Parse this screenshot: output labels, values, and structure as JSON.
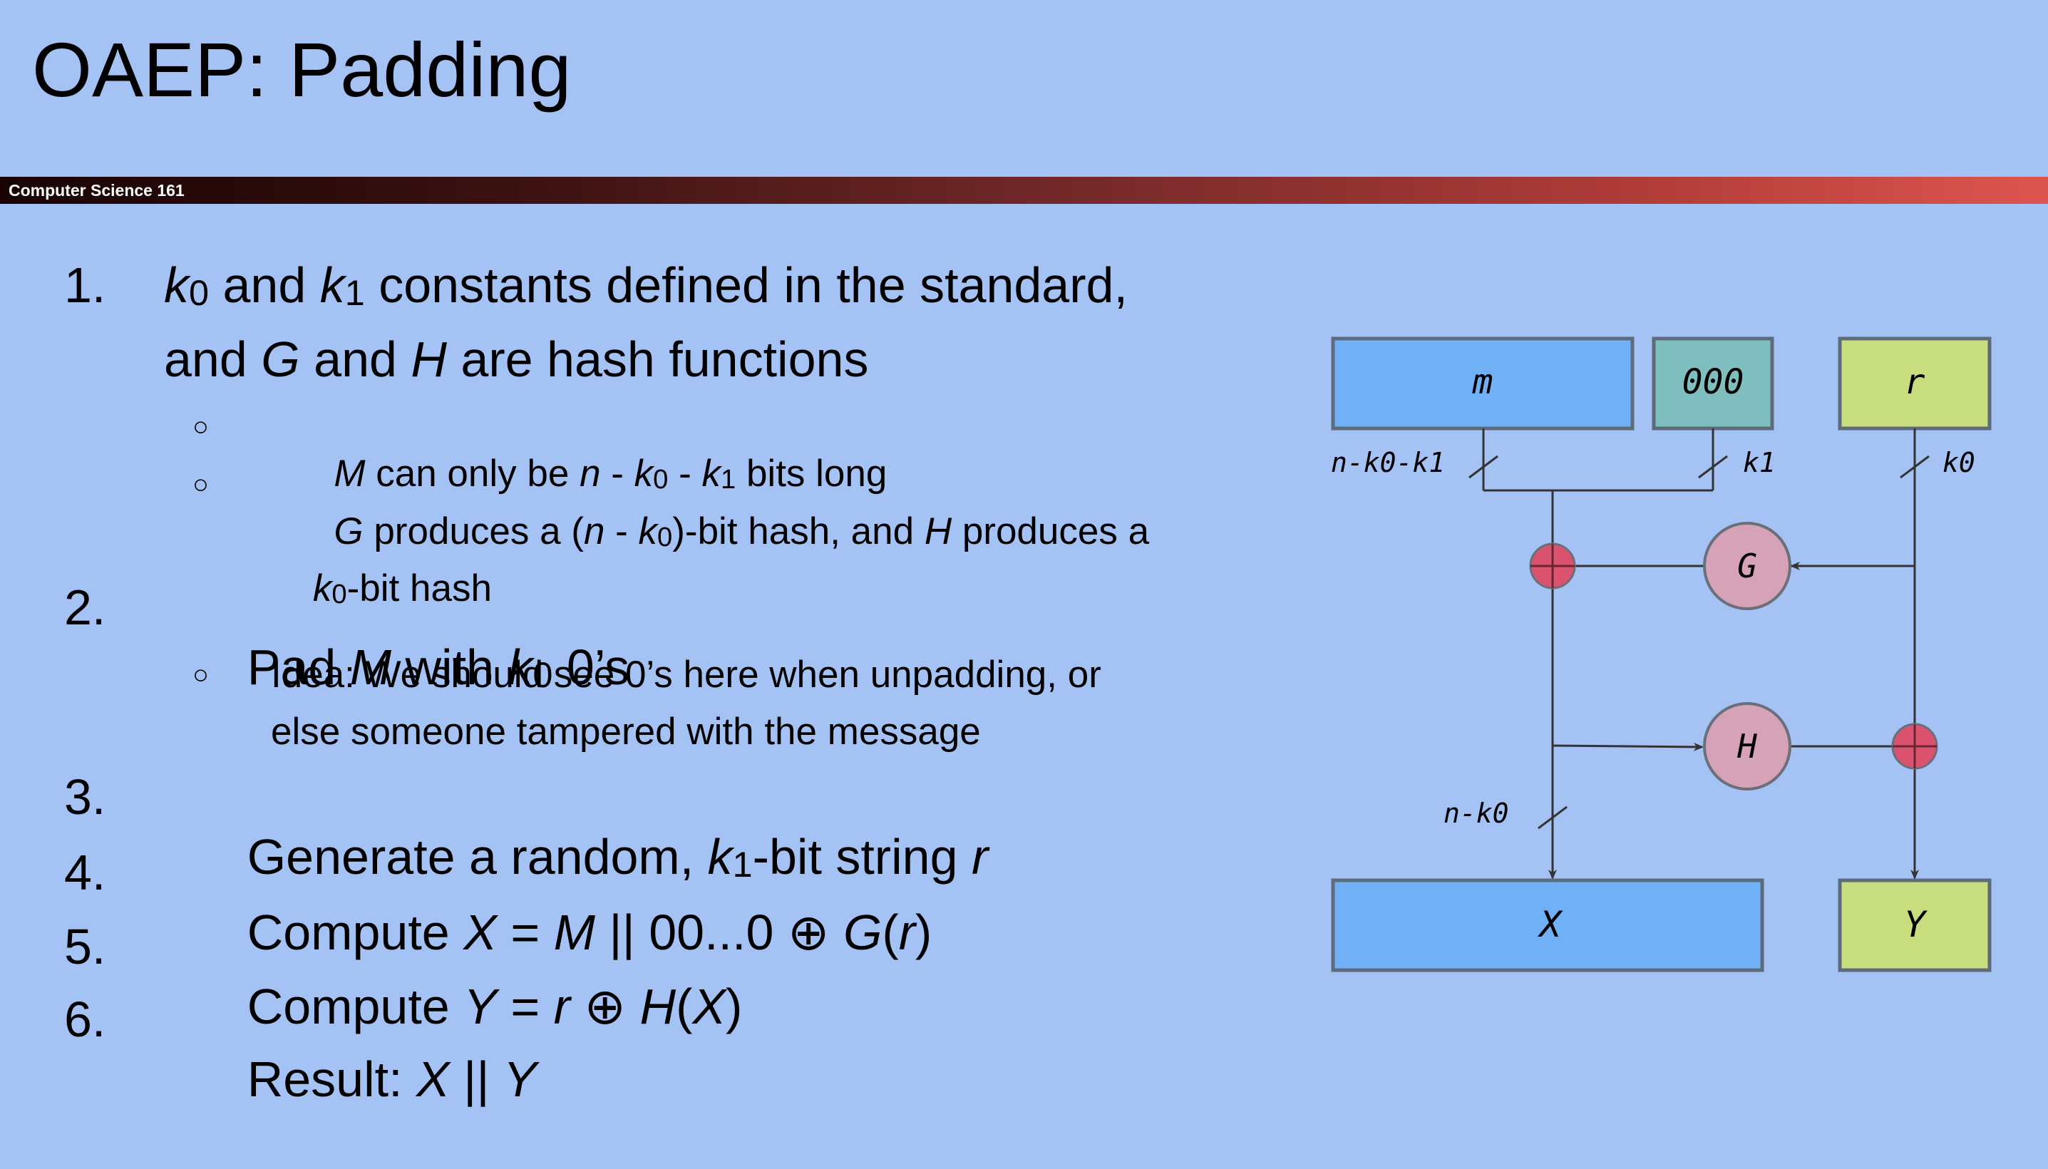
{
  "slide": {
    "title": "OAEP: Padding",
    "course_label": "Computer Science 161"
  },
  "list": {
    "items": [
      {
        "number": "1.",
        "line1": {
          "k0": "k",
          "sub0": "0",
          "and1": " and ",
          "k1": "k",
          "sub1": "1",
          "rest": " constants defined in the standard,"
        },
        "line2": {
          "t1": "and ",
          "G": "G",
          "t2": " and ",
          "H": "H",
          "t3": " are hash functions"
        }
      },
      {
        "number": "2.",
        "pre": "Pad ",
        "M": "M",
        "mid": " with ",
        "k": "k",
        "sub": "0",
        "post": " 0’s"
      },
      {
        "number": "3.",
        "pre": "Generate a random, ",
        "k": "k",
        "sub": "1",
        "mid": "-bit string ",
        "r": "r"
      },
      {
        "number": "4.",
        "pre": "Compute ",
        "X": "X",
        "eq": " = ",
        "M": "M",
        "mid": " || 00...0 ⊕ ",
        "G": "G",
        "p1": "(",
        "r": "r",
        "p2": ")"
      },
      {
        "number": "5.",
        "pre": "Compute ",
        "Y": "Y",
        "eq": " = ",
        "r": "r",
        "mid": " ⊕ ",
        "H": "H",
        "p1": "(",
        "X": "X",
        "p2": ")"
      },
      {
        "number": "6.",
        "pre": "Result: ",
        "X": "X",
        "mid": " || ",
        "Y": "Y"
      }
    ],
    "sub_items": {
      "a": {
        "bullet": "○",
        "M": "M",
        "t1": " can only be ",
        "n": "n",
        "t2": " - ",
        "k0": "k",
        "s0": "0",
        "t3": " - ",
        "k1": "k",
        "s1": "1",
        "t4": " bits long"
      },
      "b": {
        "bullet": "○",
        "G": "G",
        "t1": " produces a (",
        "n": "n",
        "t2": " - ",
        "k": "k",
        "s": "0",
        "t3": ")-bit hash, and ",
        "H": "H",
        "t4": " produces a",
        "k2": "k",
        "s2": "0",
        "t5": "-bit hash"
      },
      "c": {
        "bullet": "○",
        "line1": "Idea: We should see 0’s here when unpadding, or",
        "line2": "else someone tampered with the message"
      }
    }
  },
  "diagram": {
    "boxes": {
      "m": "m",
      "zeros": "000",
      "r": "r",
      "X": "X",
      "Y": "Y"
    },
    "functions": {
      "G": "G",
      "H": "H"
    },
    "labels": {
      "n_k0_k1": "n-k0-k1",
      "k1": "k1",
      "k0": "k0",
      "n_k0": "n-k0"
    },
    "colors": {
      "m_box": "#6fb0f6",
      "zeros_box": "#7ebebe",
      "r_box": "#c7dd7e",
      "X_box": "#6fb0f6",
      "Y_box": "#c7dd7e",
      "hash_circle": "#d6a2b8",
      "xor_circle": "#d9536f",
      "line": "#333333"
    }
  }
}
